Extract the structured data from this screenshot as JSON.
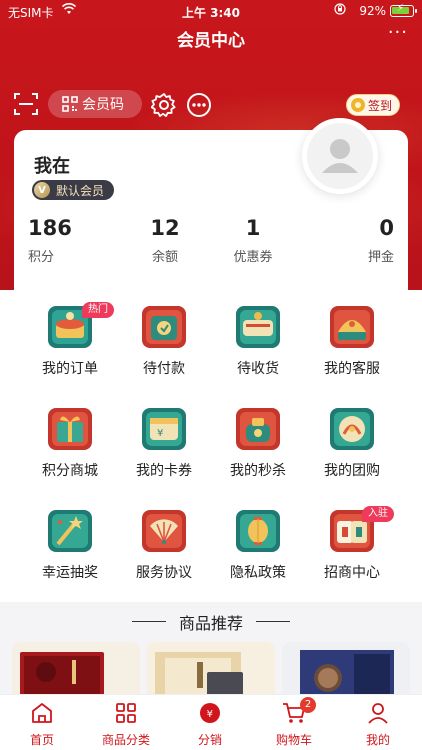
{
  "status_bar": {
    "carrier": "无SIM卡",
    "time": "上午 3:40",
    "battery_percent": "92%",
    "battery_level": 0.92
  },
  "header": {
    "title": "会员中心",
    "more_icon": "more-dots-icon"
  },
  "toolbar": {
    "member_code_label": "会员码",
    "checkin_label": "签到"
  },
  "member": {
    "name": "我在",
    "level": "默认会员",
    "stats": [
      {
        "value": "186",
        "label": "积分"
      },
      {
        "value": "12",
        "label": "余额"
      },
      {
        "value": "1",
        "label": "优惠券"
      },
      {
        "value": "0",
        "label": "押金"
      }
    ]
  },
  "services": [
    {
      "label": "我的订单",
      "icon": "order-box-icon",
      "tag": "热门"
    },
    {
      "label": "待付款",
      "icon": "wallet-pay-icon"
    },
    {
      "label": "待收货",
      "icon": "receive-box-icon"
    },
    {
      "label": "我的客服",
      "icon": "customer-service-icon"
    },
    {
      "label": "积分商城",
      "icon": "gift-box-icon"
    },
    {
      "label": "我的卡券",
      "icon": "card-voucher-icon"
    },
    {
      "label": "我的秒杀",
      "icon": "flash-sale-icon"
    },
    {
      "label": "我的团购",
      "icon": "group-buy-icon"
    },
    {
      "label": "幸运抽奖",
      "icon": "lucky-draw-icon"
    },
    {
      "label": "服务协议",
      "icon": "service-agreement-icon"
    },
    {
      "label": "隐私政策",
      "icon": "privacy-lantern-icon"
    },
    {
      "label": "招商中心",
      "icon": "merchant-mahjong-icon",
      "tag": "入驻"
    }
  ],
  "recommend": {
    "title": "商品推荐"
  },
  "tabbar": {
    "tabs": [
      {
        "label": "首页",
        "icon": "home-icon"
      },
      {
        "label": "商品分类",
        "icon": "category-grid-icon"
      },
      {
        "label": "分销",
        "icon": "distribution-coin-icon"
      },
      {
        "label": "购物车",
        "icon": "cart-icon",
        "badge": "2"
      },
      {
        "label": "我的",
        "icon": "profile-icon"
      }
    ]
  },
  "colors": {
    "brand_red": "#c8171c",
    "tab_active": "#d0161c",
    "tag_pink": "#ef3b5b"
  }
}
